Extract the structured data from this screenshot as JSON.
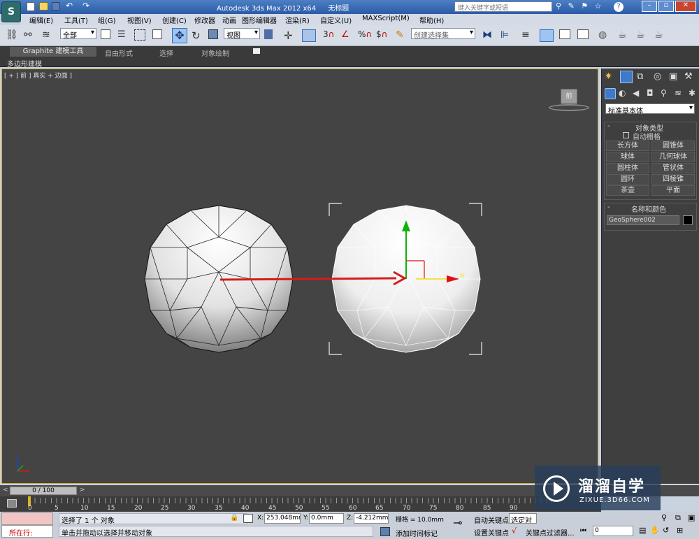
{
  "window": {
    "title": "Autodesk 3ds Max  2012 x64",
    "doc_title": "无标题",
    "search_placeholder": "键入关键字或短语"
  },
  "menu": [
    "编辑(E)",
    "工具(T)",
    "组(G)",
    "视图(V)",
    "创建(C)",
    "修改器",
    "动画",
    "图形编辑器",
    "渲染(R)",
    "自定义(U)",
    "MAXScript(M)",
    "帮助(H)"
  ],
  "toolbar": {
    "selection_filter": "全部",
    "ref_coord": "视图",
    "snap_3": "3",
    "selection_set": "创建选择集"
  },
  "ribbon": {
    "tabs": [
      "Graphite 建模工具",
      "自由形式",
      "选择",
      "对象绘制"
    ],
    "sub": "多边形建模"
  },
  "viewport": {
    "label": "[ + ] 前 ] 真实 + 边面 ]",
    "viewcube": "前",
    "gizmo_y": "y"
  },
  "cmd": {
    "dropdown": "标准基本体",
    "rollout_object_type": "对象类型",
    "autogrid": "自动栅格",
    "buttons": [
      "长方体",
      "圆锥体",
      "球体",
      "几何球体",
      "圆柱体",
      "管状体",
      "圆环",
      "四棱锥",
      "茶壶",
      "平面"
    ],
    "rollout_name_color": "名称和颜色",
    "object_name": "GeoSphere002",
    "object_color": "#000000"
  },
  "timeline": {
    "frame": "0 / 100",
    "ticks": [
      "0",
      "5",
      "10",
      "15",
      "20",
      "25",
      "30",
      "35",
      "40",
      "45",
      "50",
      "55",
      "60",
      "65",
      "70",
      "75",
      "80",
      "85",
      "90"
    ]
  },
  "status": {
    "maxscript": "所在行:",
    "selected": "选择了 1 个 对象",
    "prompt": "单击并拖动以选择并移动对象",
    "x_label": "X:",
    "x_val": "253.048mr",
    "y_label": "Y:",
    "y_val": "0.0mm",
    "z_label": "Z:",
    "z_val": "-4.212mm",
    "grid": "栅格 = 10.0mm",
    "add_time_tag": "添加时间标记",
    "auto_key": "自动关键点",
    "set_key": "设置关键点",
    "selected_obj": "选定对象",
    "key_filters": "关键点过滤器...",
    "frame_input": "0"
  },
  "watermark": {
    "brand": "溜溜自学",
    "url": "ZIXUE.3D66.COM"
  }
}
